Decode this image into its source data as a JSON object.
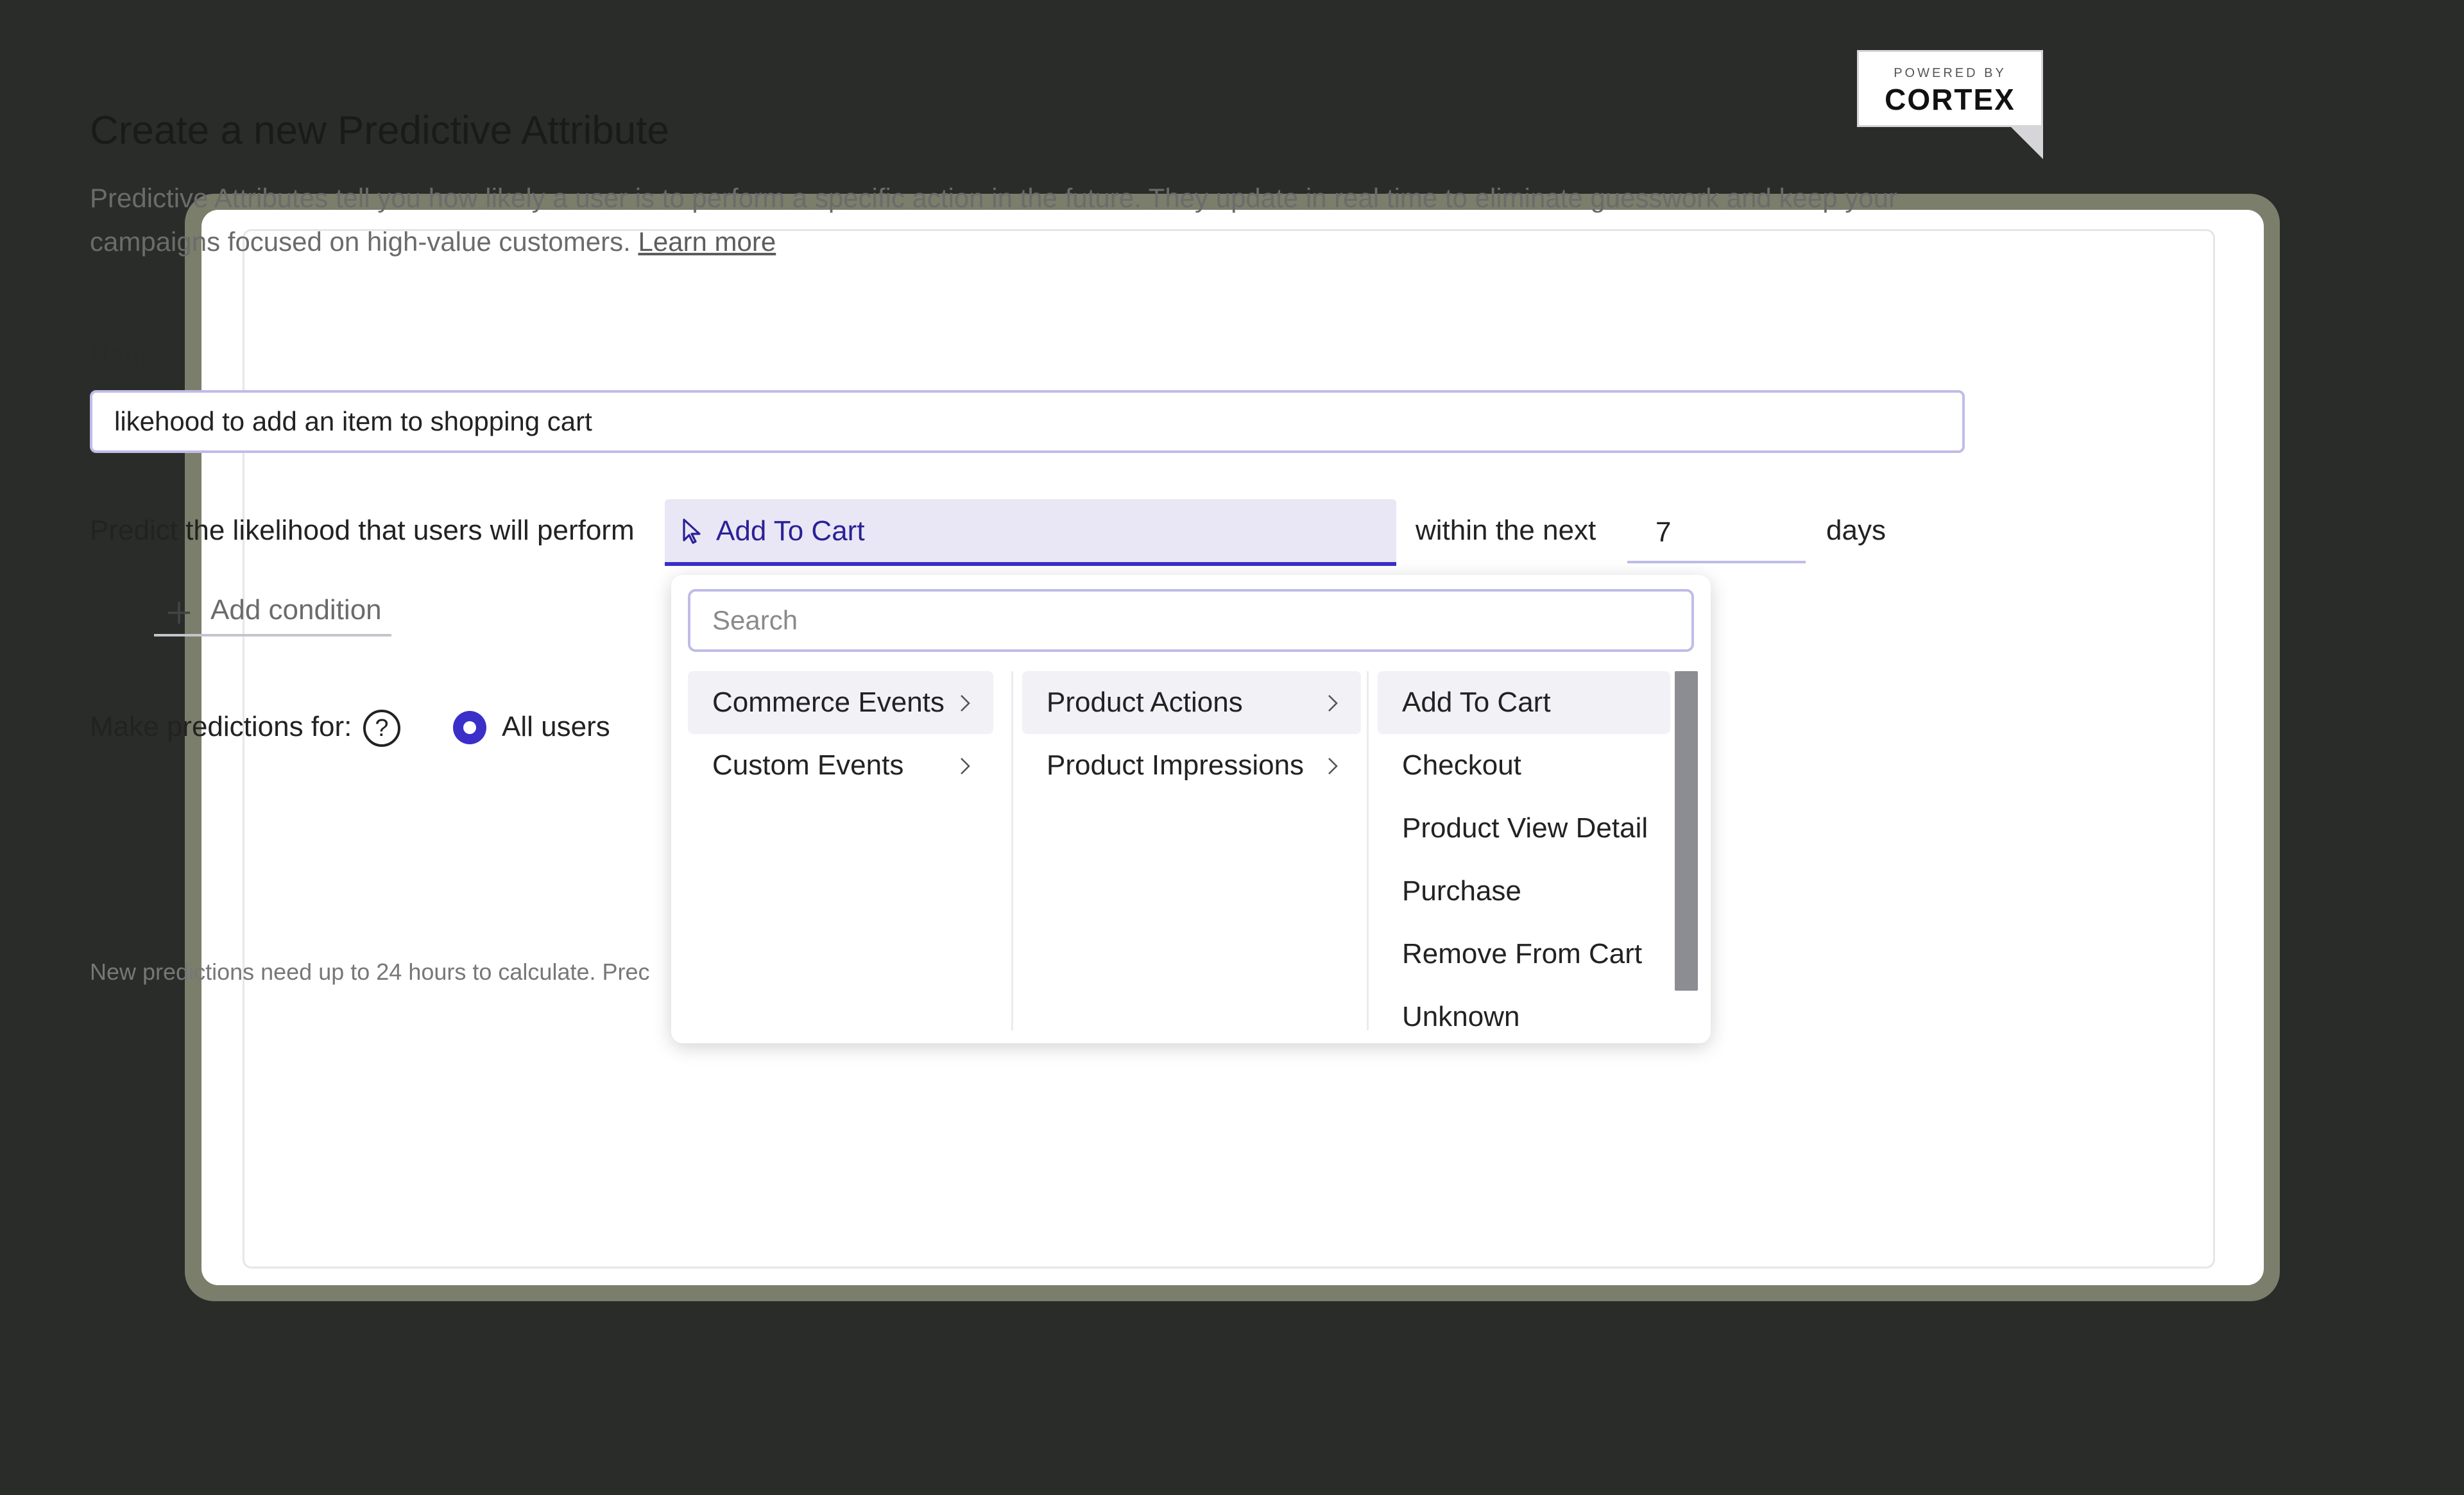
{
  "badge": {
    "powered_by": "POWERED BY",
    "brand": "CORTEX"
  },
  "page": {
    "title": "Create a new Predictive Attribute",
    "description": "Predictive Attributes tell you how likely a user is to perform a specific action in the future. They update in real time to eliminate guesswork and keep your campaigns focused on high-value customers.",
    "learn_more": "Learn more"
  },
  "form": {
    "name_label": "Name :",
    "name_value": "likehood to add an item to shopping cart",
    "predict_text": "Predict the likelihood that users will perform",
    "selected_event": "Add To Cart",
    "within_text": "within the next",
    "days_value": "7",
    "days_label": "days",
    "add_condition": "Add condition",
    "make_predictions_label": "Make predictions for:",
    "help_symbol": "?",
    "audience_option": "All users",
    "footnote": "New predictions need up to 24 hours to calculate. Prec"
  },
  "dropdown": {
    "search_placeholder": "Search",
    "categories": [
      "Commerce Events",
      "Custom Events"
    ],
    "subcategories": [
      "Product Actions",
      "Product Impressions"
    ],
    "events": [
      "Add To Cart",
      "Checkout",
      "Product View Detail",
      "Purchase",
      "Remove From Cart",
      "Unknown"
    ]
  },
  "colors": {
    "accent": "#3b2fc9",
    "select_bg": "#e9e7f5",
    "frame": "#7b7e6b",
    "background": "#2a2c29"
  }
}
